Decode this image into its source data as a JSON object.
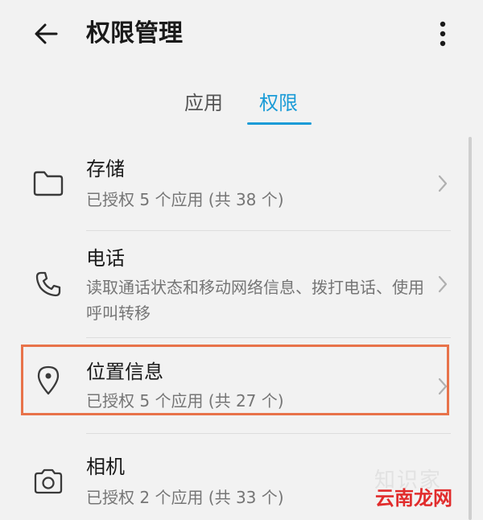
{
  "header": {
    "title": "权限管理"
  },
  "tabs": [
    {
      "label": "应用",
      "active": false
    },
    {
      "label": "权限",
      "active": true
    }
  ],
  "permissions": [
    {
      "name": "存储",
      "desc": "已授权 5 个应用 (共 38 个)",
      "icon": "folder-icon"
    },
    {
      "name": "电话",
      "desc": "读取通话状态和移动网络信息、拨打电话、使用呼叫转移",
      "icon": "phone-icon"
    },
    {
      "name": "位置信息",
      "desc": "已授权 5 个应用 (共 27 个)",
      "icon": "location-pin-icon",
      "highlighted": true
    },
    {
      "name": "相机",
      "desc": "已授权 2 个应用 (共 33 个)",
      "icon": "camera-icon"
    }
  ],
  "watermark": {
    "text": "知识家",
    "logo": "云南龙网"
  },
  "colors": {
    "accent": "#1a9bd7",
    "highlight": "#e8734a",
    "background": "#f2f2f2",
    "logo": "#e12c2c"
  }
}
